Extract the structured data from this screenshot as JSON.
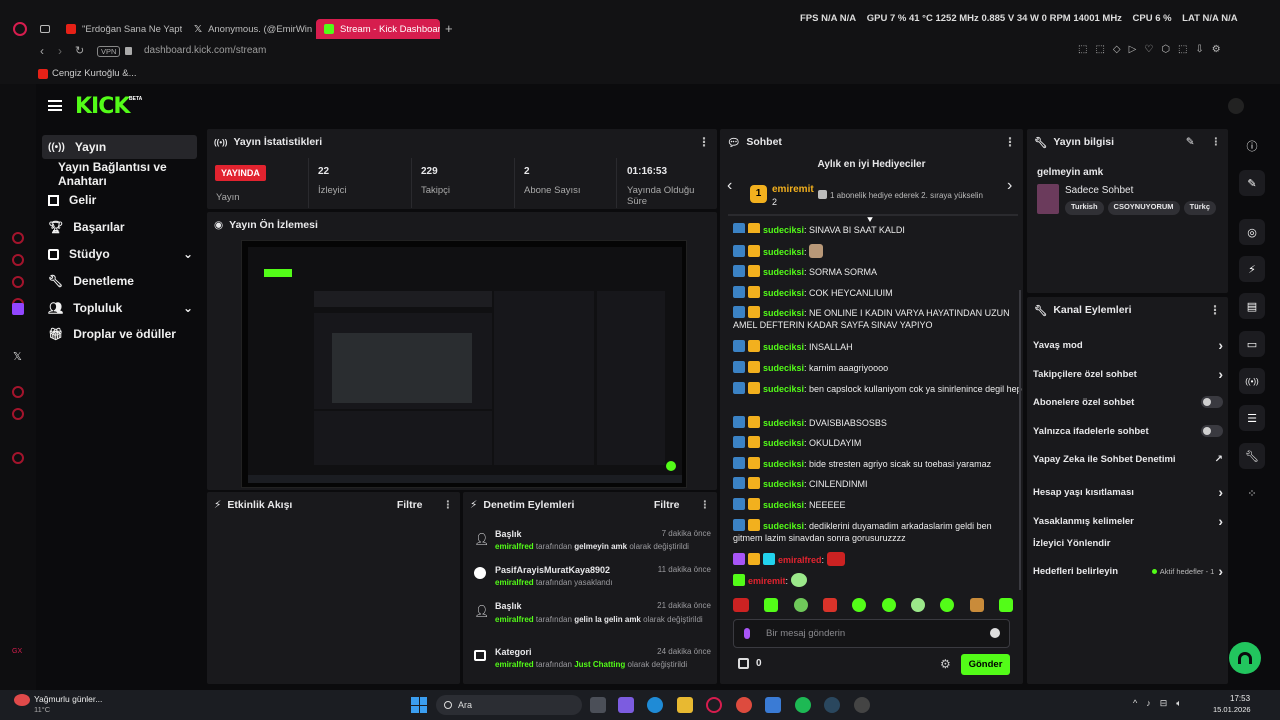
{
  "browser": {
    "tabs": [
      {
        "label": "\"Erdoğan Sana Ne Yaptı..\""
      },
      {
        "label": "Anonymous. (@EmirWinc..."
      },
      {
        "label": "Stream - Kick Dashboard"
      }
    ],
    "address": "dashboard.kick.com/stream",
    "vpn": "VPN",
    "bookmark": "Cengiz Kurtoğlu &...",
    "hud": {
      "fps_label": "FPS",
      "fps": "N/A",
      "fps2": "N/A",
      "gpu_label": "GPU",
      "gpu_pct": "7 %",
      "gpu_temp": "41 °C",
      "gpu_mhz": "1252 MHz",
      "gpu_v": "0.885 V",
      "gpu_w": "34 W",
      "gpu_rpm": "0 RPM",
      "gpu_mem": "14001 MHz",
      "cpu_label": "CPU",
      "cpu_pct": "6 %",
      "lat_label": "LAT",
      "lat": "N/A",
      "lat2": "N/A"
    }
  },
  "header": {
    "logo": "KICK",
    "beta": "BETA"
  },
  "nav": [
    {
      "label": "Yayın"
    },
    {
      "label": "Yayın Bağlantısı ve Anahtarı"
    },
    {
      "label": "Gelir"
    },
    {
      "label": "Başarılar"
    },
    {
      "label": "Stüdyo"
    },
    {
      "label": "Denetleme"
    },
    {
      "label": "Topluluk"
    },
    {
      "label": "Droplar ve ödüller"
    }
  ],
  "stats": {
    "title": "Yayın İstatistikleri",
    "live": "YAYINDA",
    "live_label": "Yayın",
    "items": [
      {
        "value": "22",
        "label": "İzleyici"
      },
      {
        "value": "229",
        "label": "Takipçi"
      },
      {
        "value": "2",
        "label": "Abone Sayısı"
      },
      {
        "value": "01:16:53",
        "label": "Yayında Olduğu Süre"
      }
    ]
  },
  "preview": {
    "title": "Yayın Ön İzlemesi"
  },
  "activity": {
    "title": "Etkinlik Akışı",
    "filter": "Filtre"
  },
  "moderation": {
    "title": "Denetim Eylemleri",
    "filter": "Filtre",
    "items": [
      {
        "kind": "Başlık",
        "time": "7 dakika önce",
        "actor": "emiralfred",
        "mid": "tarafından",
        "value": "gelmeyin amk",
        "tail": "olarak değiştirildi"
      },
      {
        "kind": "PasifArayisMuratKaya8902",
        "time": "11 dakika önce",
        "actor": "emiralfred",
        "mid": "tarafından yasaklandı",
        "value": "",
        "tail": ""
      },
      {
        "kind": "Başlık",
        "time": "21 dakika önce",
        "actor": "emiralfred",
        "mid": "tarafından",
        "value": "gelin la gelin amk",
        "tail": "olarak değiştirildi"
      },
      {
        "kind": "Kategori",
        "time": "24 dakika önce",
        "actor": "emiralfred",
        "mid": "tarafından",
        "value": "Just Chatting",
        "tail": "olarak değiştirildi"
      }
    ]
  },
  "chat": {
    "title": "Sohbet",
    "gifter_title": "Aylık en iyi Hediyeciler",
    "gifter_rank": "1",
    "gifter_name": "emiremit",
    "gifter_count": "2",
    "gifter_hint": "1 abonelik hediye ederek 2. sıraya yükselin",
    "lines": [
      {
        "user": "sudeciksi",
        "text": "SINAVA BI SAAT KALDI"
      },
      {
        "user": "sudeciksi",
        "text": ""
      },
      {
        "user": "sudeciksi",
        "text": "SORMA SORMA"
      },
      {
        "user": "sudeciksi",
        "text": "COK HEYCANLIUIM"
      },
      {
        "user": "sudeciksi",
        "text": "NE ONLINE I KADIN VARYA HAYATINDAN UZUN AMEL DEFTERIN KADAR SAYFA SINAV YAPIYO"
      },
      {
        "user": "sudeciksi",
        "text": "INSALLAH"
      },
      {
        "user": "sudeciksi",
        "text": "karnim aaagriyoooo"
      },
      {
        "user": "sudeciksi",
        "text": "ben capslock kullaniyom cok ya sinirlenince degil hep"
      },
      {
        "user": "sudeciksi",
        "text": "DVAISBIABSOSBS"
      },
      {
        "user": "sudeciksi",
        "text": "OKULDAYIM"
      },
      {
        "user": "sudeciksi",
        "text": "bide stresten agriyo sicak su toebasi yaramaz"
      },
      {
        "user": "sudeciksi",
        "text": "CINLENDINMI"
      },
      {
        "user": "sudeciksi",
        "text": "NEEEEE"
      },
      {
        "user": "sudeciksi",
        "text": "dediklerini duyamadim arkadaslarim geldi ben gitmem lazim sinavdan sonra gorusuruzzzz"
      },
      {
        "user": "emiralfred",
        "text": ""
      },
      {
        "user": "emiremit",
        "text": ""
      }
    ],
    "placeholder": "Bir mesaj gönderin",
    "points": "0",
    "send": "Gönder"
  },
  "info": {
    "title": "Yayın bilgisi",
    "stream_title": "gelmeyin amk",
    "category": "Sadece Sohbet",
    "tags": [
      "Turkish",
      "CSOYNUYORUM",
      "Türkç"
    ]
  },
  "actions": {
    "title": "Kanal Eylemleri",
    "items": [
      {
        "label": "Yavaş mod",
        "ctl": "chevron"
      },
      {
        "label": "Takipçilere özel sohbet",
        "ctl": "chevron"
      },
      {
        "label": "Abonelere özel sohbet",
        "ctl": "toggle"
      },
      {
        "label": "Yalnızca ifadelerle sohbet",
        "ctl": "toggle"
      },
      {
        "label": "Yapay Zeka ile Sohbet Denetimi",
        "ctl": "external"
      },
      {
        "label": "Hesap yaşı kısıtlaması",
        "ctl": "chevron"
      },
      {
        "label": "Yasaklanmış kelimeler",
        "ctl": "chevron"
      },
      {
        "label": "İzleyici Yönlendir",
        "ctl": "none"
      },
      {
        "label": "Hedefleri belirleyin",
        "ctl": "chevron"
      }
    ],
    "goal_status": "Aktif hedefler - 1"
  },
  "taskbar": {
    "weather": "Yağmurlu günler...",
    "temp": "11°C",
    "search": "Ara",
    "time": "17:53",
    "date": "15.01.2026"
  },
  "colors": {
    "accent": "#53fc18",
    "live": "#e2232f",
    "tab_active": "#d61d4e"
  }
}
